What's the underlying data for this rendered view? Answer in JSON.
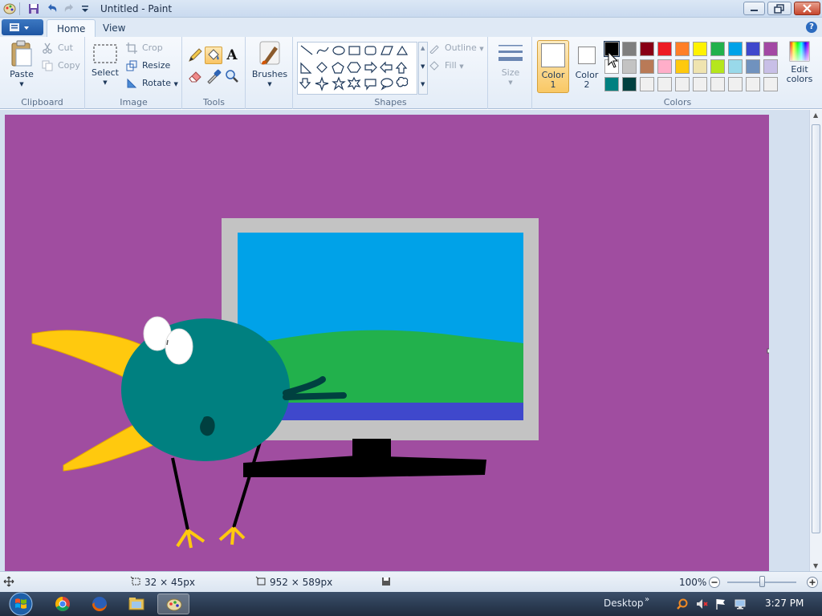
{
  "window": {
    "title": "Untitled - Paint",
    "minimize_icon": "minimize-icon",
    "maximize_icon": "maximize-icon",
    "close_icon": "close-icon"
  },
  "quick_access": [
    "save-icon",
    "undo-icon",
    "redo-icon",
    "customize-icon"
  ],
  "tabs": [
    {
      "label": "Home",
      "active": true
    },
    {
      "label": "View",
      "active": false
    }
  ],
  "ribbon": {
    "clipboard": {
      "group_label": "Clipboard",
      "paste_label": "Paste",
      "cut_label": "Cut",
      "copy_label": "Copy"
    },
    "image": {
      "group_label": "Image",
      "select_label": "Select",
      "crop_label": "Crop",
      "resize_label": "Resize",
      "rotate_label": "Rotate"
    },
    "tools": {
      "group_label": "Tools",
      "text_tool_label": "A",
      "items": [
        "pencil-icon",
        "fill-icon",
        "text-icon",
        "eraser-icon",
        "color-picker-icon",
        "magnifier-icon"
      ],
      "active": "fill-icon"
    },
    "brushes": {
      "label": "Brushes"
    },
    "shapes": {
      "group_label": "Shapes",
      "outline_label": "Outline",
      "fill_label": "Fill"
    },
    "size": {
      "label": "Size"
    },
    "colors": {
      "group_label": "Colors",
      "color1_label_line1": "Color",
      "color1_label_line2": "1",
      "color2_label_line1": "Color",
      "color2_label_line2": "2",
      "edit_label_line1": "Edit",
      "edit_label_line2": "colors",
      "color1": "#ffffff",
      "color2": "#ffffff",
      "palette_row1": [
        "#000000",
        "#7f7f7f",
        "#880015",
        "#ed1c24",
        "#ff7f27",
        "#fff200",
        "#22b14c",
        "#00a2e8",
        "#3f48cc",
        "#a349a4"
      ],
      "palette_row2": [
        "#ffffff",
        "#c3c3c3",
        "#b97a57",
        "#ffaec9",
        "#ffc90e",
        "#efe4b0",
        "#b5e61d",
        "#99d9ea",
        "#7092be",
        "#c8bfe7"
      ],
      "palette_row3": [
        "#008080",
        "#004040",
        "#f0f0f0",
        "#f0f0f0",
        "#f0f0f0",
        "#f0f0f0",
        "#f0f0f0",
        "#f0f0f0",
        "#f0f0f0",
        "#f0f0f0"
      ],
      "selected_index": 0
    }
  },
  "canvas": {
    "background": "#a04da0",
    "image": "drawing of a teal bird beside a computer monitor"
  },
  "status": {
    "selection_size": "32 × 45px",
    "canvas_size": "952 × 589px",
    "zoom": "100%"
  },
  "taskbar": {
    "apps": [
      "chrome-icon",
      "firefox-icon",
      "explorer-icon",
      "paint-icon"
    ],
    "active_app": "paint-icon",
    "desktop_label": "Desktop",
    "clock": "3:27 PM"
  }
}
